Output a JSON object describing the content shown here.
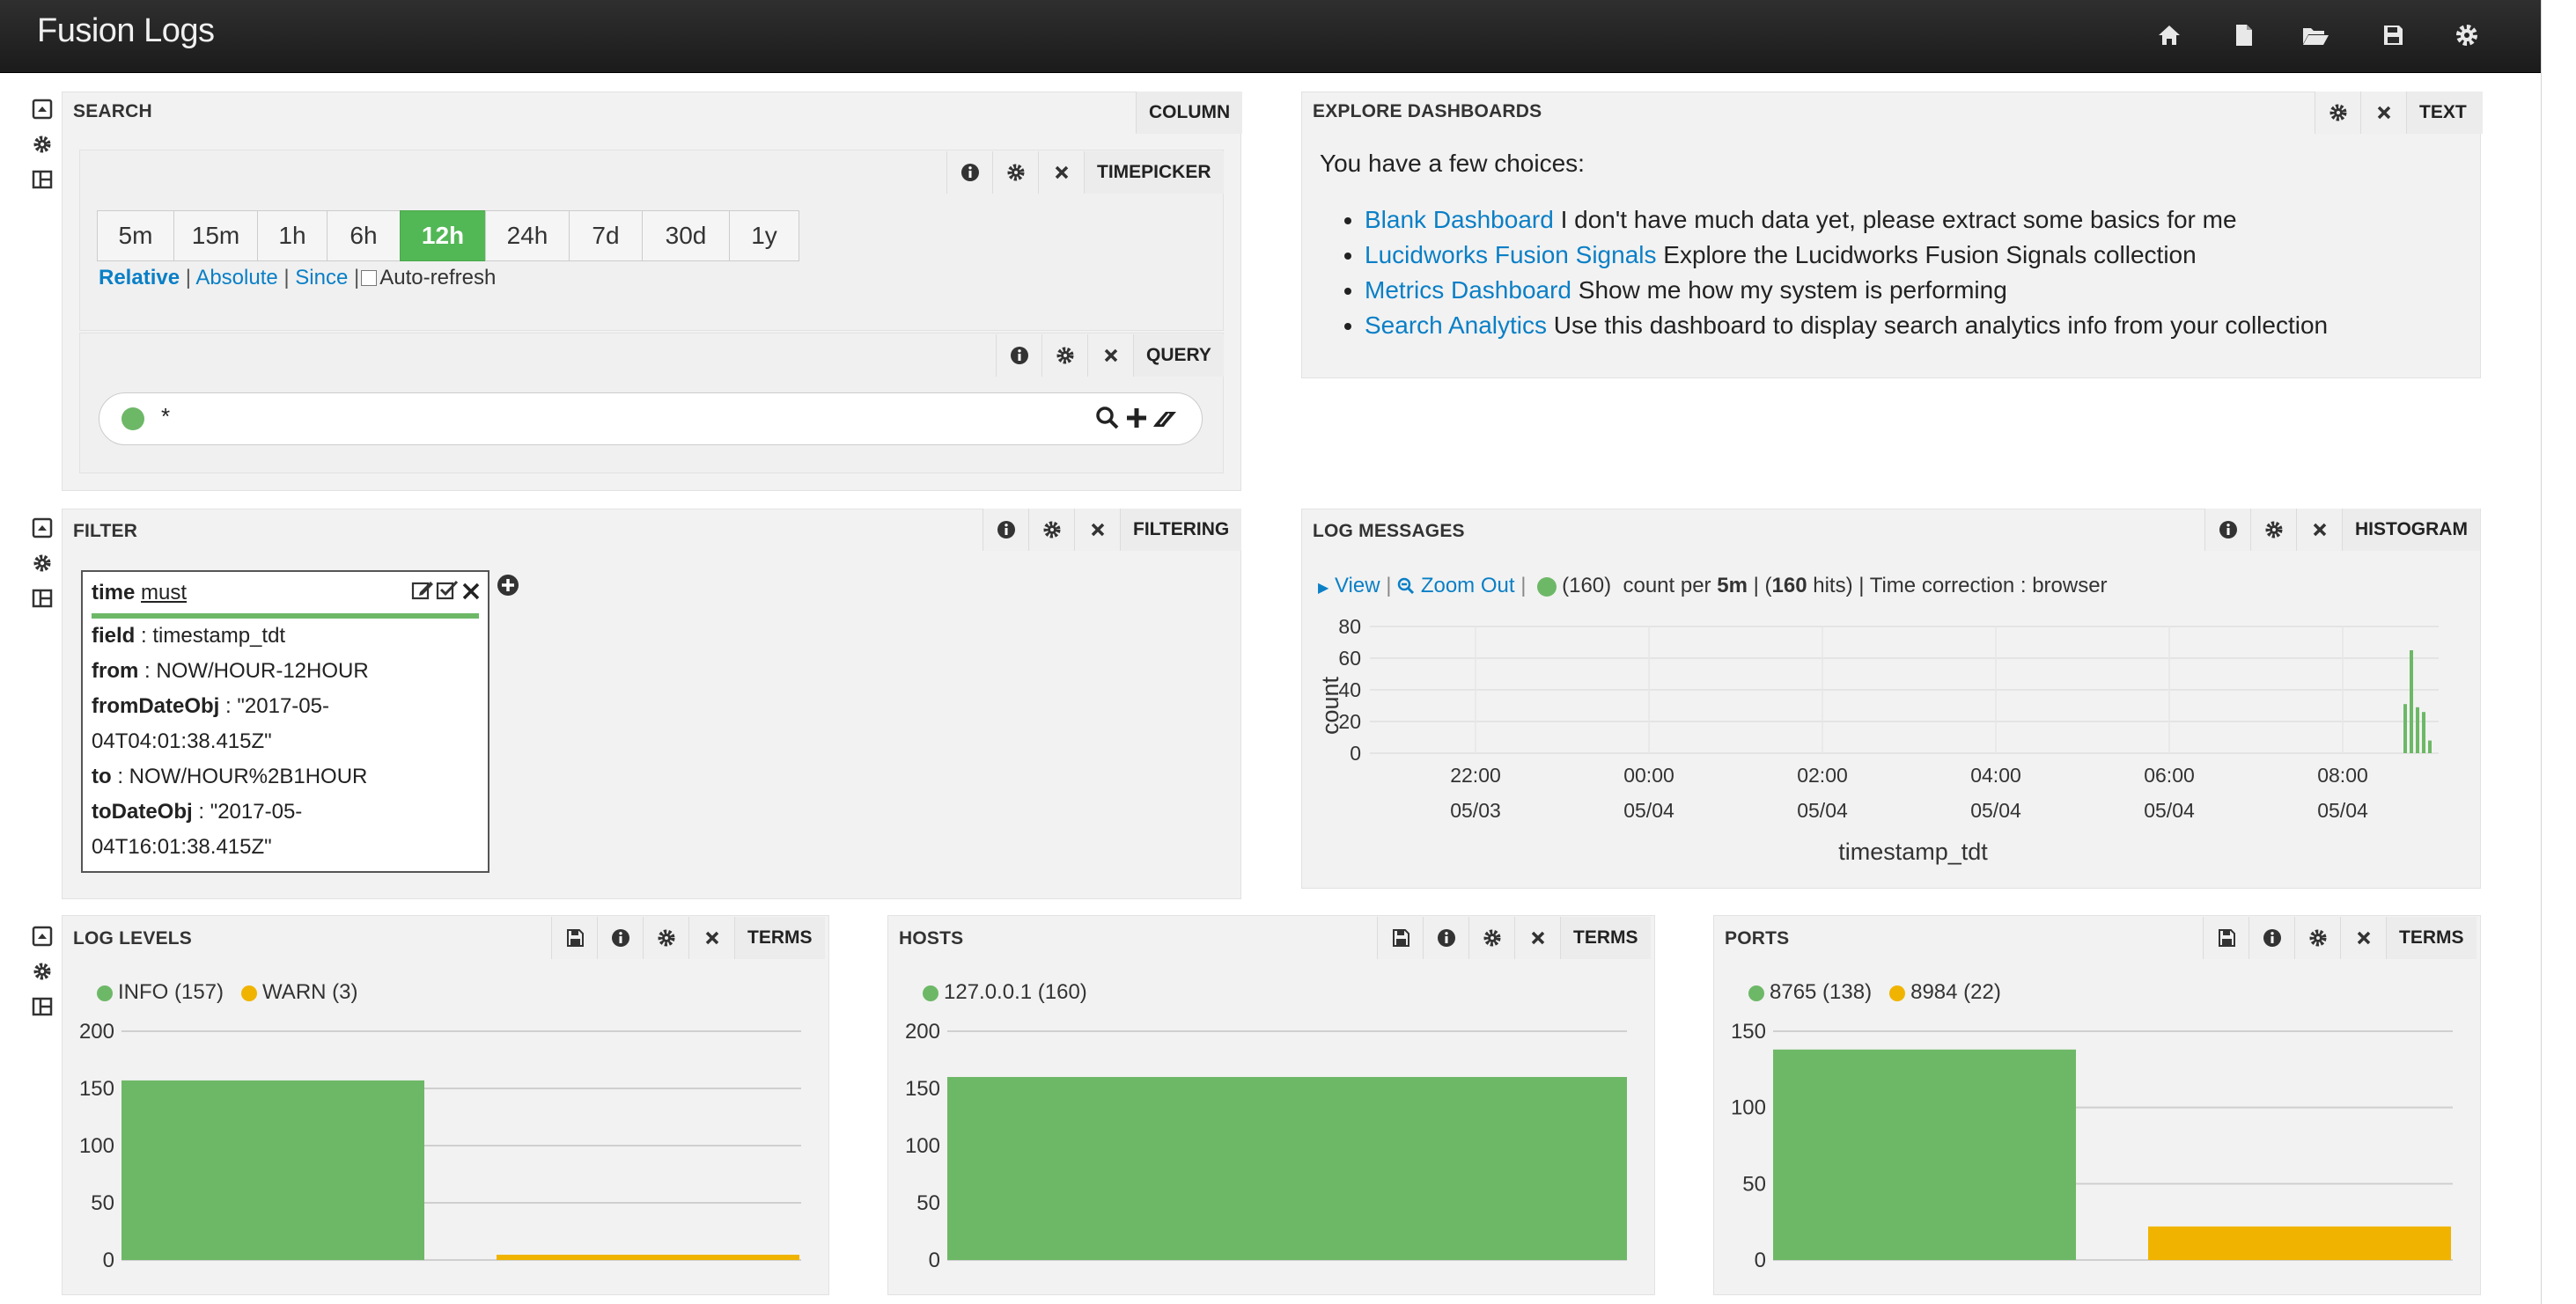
{
  "app": {
    "title": "Fusion Logs"
  },
  "nav_icons": [
    "home-icon",
    "file-icon",
    "folder-open-icon",
    "save-icon",
    "gear-icon"
  ],
  "search_panel": {
    "title": "SEARCH",
    "type": "COLUMN",
    "timepicker": {
      "type": "TIMEPICKER",
      "buttons": [
        "5m",
        "15m",
        "1h",
        "6h",
        "12h",
        "24h",
        "7d",
        "30d",
        "1y"
      ],
      "active": "12h",
      "modes": {
        "relative": "Relative",
        "absolute": "Absolute",
        "since": "Since",
        "sep": "|",
        "autorefresh": "Auto-refresh"
      }
    },
    "query": {
      "type": "QUERY",
      "value": "*"
    }
  },
  "explore": {
    "title": "EXPLORE DASHBOARDS",
    "type": "TEXT",
    "intro": "You have a few choices:",
    "items": [
      {
        "link": "Blank Dashboard",
        "text": " I don't have much data yet, please extract some basics for me"
      },
      {
        "link": "Lucidworks Fusion Signals",
        "text": " Explore the Lucidworks Fusion Signals collection"
      },
      {
        "link": "Metrics Dashboard",
        "text": " Show me how my system is performing"
      },
      {
        "link": "Search Analytics",
        "text": " Use this dashboard to display search analytics info from your collection"
      }
    ]
  },
  "filter_panel": {
    "title": "FILTER",
    "type": "FILTERING",
    "card": {
      "name": "time",
      "mode": "must",
      "rows": [
        {
          "key": "field",
          "value": "timestamp_tdt"
        },
        {
          "key": "from",
          "value": "NOW/HOUR-12HOUR"
        },
        {
          "key": "fromDateObj",
          "value": "\"2017-05-",
          "cont": "04T04:01:38.415Z\""
        },
        {
          "key": "to",
          "value": "NOW/HOUR%2B1HOUR"
        },
        {
          "key": "toDateObj",
          "value": "\"2017-05-",
          "cont": "04T16:01:38.415Z\""
        }
      ]
    }
  },
  "log_messages": {
    "title": "LOG MESSAGES",
    "type": "HISTOGRAM",
    "toolbar": {
      "view": "View",
      "zoom_out": "Zoom Out",
      "sep": "|",
      "count": "(160)",
      "count_per": "count per",
      "interval": "5m",
      "hits_open": "(",
      "hits_num": "160",
      "hits_close": " hits)",
      "time_correction": "| Time correction : browser"
    }
  },
  "chart_data": [
    {
      "type": "bar",
      "panel": "LOG MESSAGES",
      "xlabel": "timestamp_tdt",
      "ylabel": "count",
      "ylim": [
        0,
        80
      ],
      "yticks": [
        "80",
        "60",
        "40",
        "20",
        "0"
      ],
      "xticks": [
        {
          "time": "22:00",
          "date": "05/03"
        },
        {
          "time": "00:00",
          "date": "05/04"
        },
        {
          "time": "02:00",
          "date": "05/04"
        },
        {
          "time": "04:00",
          "date": "05/04"
        },
        {
          "time": "06:00",
          "date": "05/04"
        },
        {
          "time": "08:00",
          "date": "05/04"
        }
      ],
      "series": [
        {
          "name": "",
          "color": "#6db867",
          "values": [
            31,
            65,
            29,
            26,
            8
          ]
        }
      ],
      "grid": true
    },
    {
      "type": "bar",
      "panel": "LOG LEVELS",
      "categories": [
        "INFO (157)",
        "WARN (3)"
      ],
      "values": [
        157,
        3
      ],
      "colors": [
        "#6db867",
        "#f0b400"
      ],
      "ylim": [
        0,
        200
      ],
      "yticks": [
        "200",
        "150",
        "100",
        "50",
        "0"
      ],
      "legend": "top-left"
    },
    {
      "type": "bar",
      "panel": "HOSTS",
      "categories": [
        "127.0.0.1 (160)"
      ],
      "values": [
        160
      ],
      "colors": [
        "#6db867"
      ],
      "ylim": [
        0,
        200
      ],
      "yticks": [
        "200",
        "150",
        "100",
        "50",
        "0"
      ],
      "legend": "top-left"
    },
    {
      "type": "bar",
      "panel": "PORTS",
      "categories": [
        "8765 (138)",
        "8984 (22)"
      ],
      "values": [
        138,
        22
      ],
      "colors": [
        "#6db867",
        "#f0b400"
      ],
      "ylim": [
        0,
        150
      ],
      "yticks": [
        "150",
        "100",
        "50",
        "0"
      ],
      "legend": "top-left"
    }
  ],
  "terms_panels": [
    {
      "title": "LOG LEVELS",
      "type": "TERMS"
    },
    {
      "title": "HOSTS",
      "type": "TERMS"
    },
    {
      "title": "PORTS",
      "type": "TERMS"
    }
  ]
}
